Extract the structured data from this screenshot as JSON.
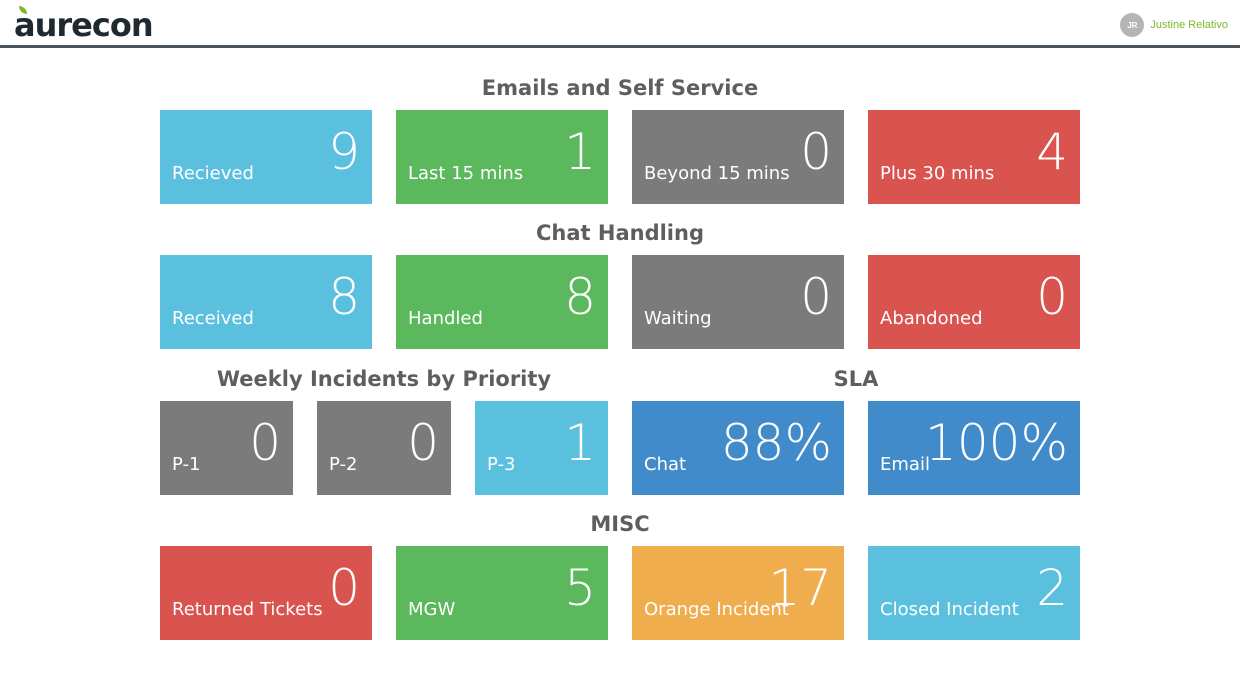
{
  "brand": {
    "logo_text": "aurecon",
    "accent": "#7cb829"
  },
  "user": {
    "initials": "JR",
    "name": "Justine Relativo"
  },
  "sections": {
    "emails": {
      "title": "Emails and Self Service",
      "tiles": [
        {
          "label": "Recieved",
          "value": "9",
          "color": "#5bc0de"
        },
        {
          "label": "Last 15 mins",
          "value": "1",
          "color": "#5cb85c"
        },
        {
          "label": "Beyond 15 mins",
          "value": "0",
          "color": "#7b7b7b"
        },
        {
          "label": "Plus 30 mins",
          "value": "4",
          "color": "#d9534f"
        }
      ]
    },
    "chat": {
      "title": "Chat Handling",
      "tiles": [
        {
          "label": "Received",
          "value": "8",
          "color": "#5bc0de"
        },
        {
          "label": "Handled",
          "value": "8",
          "color": "#5cb85c"
        },
        {
          "label": "Waiting",
          "value": "0",
          "color": "#7b7b7b"
        },
        {
          "label": "Abandoned",
          "value": "0",
          "color": "#d9534f"
        }
      ]
    },
    "incidents": {
      "title": "Weekly Incidents by Priority",
      "tiles": [
        {
          "label": "P-1",
          "value": "0",
          "color": "#7b7b7b"
        },
        {
          "label": "P-2",
          "value": "0",
          "color": "#7b7b7b"
        },
        {
          "label": "P-3",
          "value": "1",
          "color": "#5bc0de"
        }
      ]
    },
    "sla": {
      "title": "SLA",
      "tiles": [
        {
          "label": "Chat",
          "value": "88%",
          "color": "#428bca"
        },
        {
          "label": "Email",
          "value": "100%",
          "color": "#428bca"
        }
      ]
    },
    "misc": {
      "title": "MISC",
      "tiles": [
        {
          "label": "Returned Tickets",
          "value": "0",
          "color": "#d9534f"
        },
        {
          "label": "MGW",
          "value": "5",
          "color": "#5cb85c"
        },
        {
          "label": "Orange Incident",
          "value": "17",
          "color": "#f0ad4e"
        },
        {
          "label": "Closed Incident",
          "value": "2",
          "color": "#5bc0de"
        }
      ]
    }
  }
}
